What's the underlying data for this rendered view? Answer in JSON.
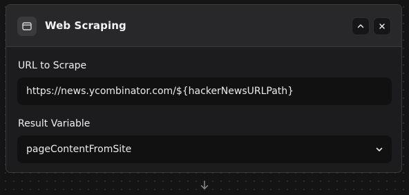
{
  "node": {
    "title": "Web Scraping",
    "icon": "browser-window-icon",
    "actions": {
      "collapse_icon": "chevron-up-icon",
      "close_icon": "close-icon"
    }
  },
  "fields": {
    "url": {
      "label": "URL to Scrape",
      "value": "https://news.ycombinator.com/${hackerNewsURLPath}"
    },
    "result_variable": {
      "label": "Result Variable",
      "selected": "pageContentFromSite"
    }
  },
  "connector": {
    "icon": "arrow-down-icon"
  },
  "colors": {
    "background": "#141414",
    "card": "#1c1b1e",
    "header": "#28272a",
    "input": "#111112",
    "text": "#f1f1f1"
  }
}
